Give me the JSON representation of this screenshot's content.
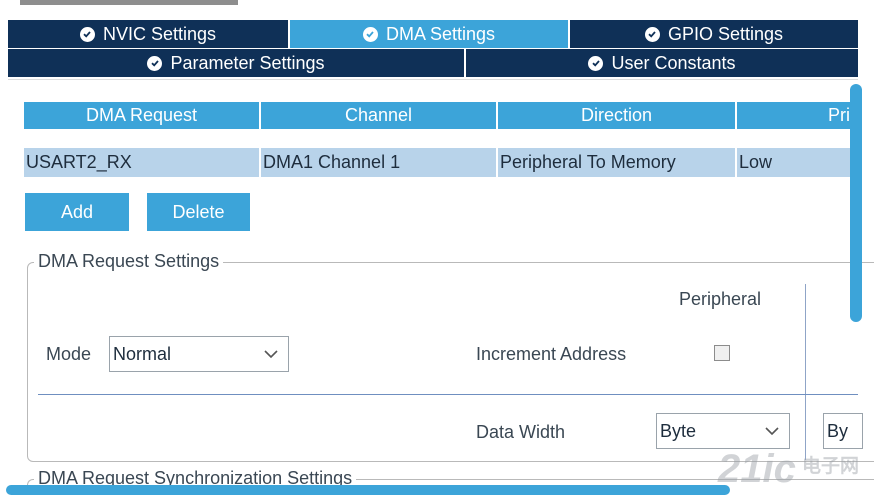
{
  "tabs": {
    "row1": [
      {
        "label": "NVIC Settings",
        "active": false
      },
      {
        "label": "DMA Settings",
        "active": true
      },
      {
        "label": "GPIO Settings",
        "active": false
      }
    ],
    "row2": [
      {
        "label": "Parameter Settings",
        "active": false
      },
      {
        "label": "User Constants",
        "active": false
      }
    ]
  },
  "dma_table": {
    "headers": [
      "DMA Request",
      "Channel",
      "Direction",
      "Pri"
    ],
    "rows": [
      [
        "USART2_RX",
        "DMA1 Channel 1",
        "Peripheral To Memory",
        "Low"
      ]
    ]
  },
  "buttons": {
    "add": "Add",
    "delete": "Delete"
  },
  "request_settings": {
    "legend": "DMA Request Settings",
    "mode_label": "Mode",
    "mode_value": "Normal",
    "peripheral_header": "Peripheral",
    "increment_address_label": "Increment Address",
    "increment_address_checked": false,
    "data_width_label": "Data Width",
    "peripheral_data_width": "Byte",
    "memory_data_width": "By"
  },
  "sync_settings": {
    "legend": "DMA Request Synchronization Settings"
  },
  "watermark": {
    "text": "21ic 电子网"
  },
  "colors": {
    "tab_dark": "#0f3057",
    "accent": "#3ca4d9",
    "row_selected": "#b8d3ea"
  }
}
